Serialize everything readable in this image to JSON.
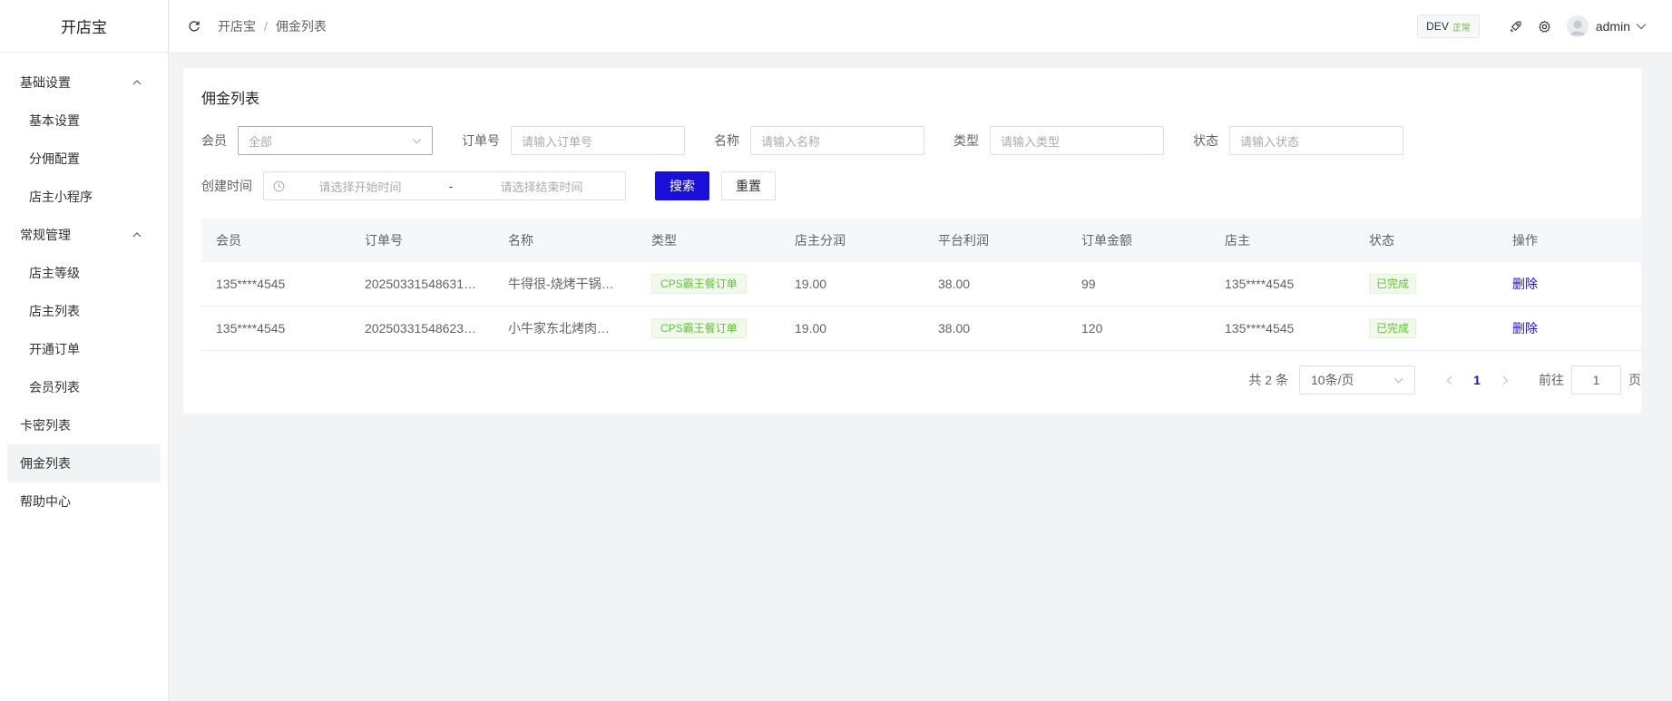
{
  "app": {
    "logo": "开店宝"
  },
  "sidebar": {
    "groups": [
      {
        "label": "基础设置",
        "items": [
          "基本设置",
          "分佣配置",
          "店主小程序"
        ]
      },
      {
        "label": "常规管理",
        "items": [
          "店主等级",
          "店主列表",
          "开通订单",
          "会员列表"
        ]
      }
    ],
    "top_items": [
      "卡密列表",
      "佣金列表",
      "帮助中心"
    ]
  },
  "header": {
    "breadcrumb": [
      "开店宝",
      "佣金列表"
    ],
    "env": "DEV",
    "env_status": "正常",
    "user": "admin"
  },
  "page": {
    "title": "佣金列表",
    "filters": {
      "member": {
        "label": "会员",
        "value": "全部"
      },
      "order_no": {
        "label": "订单号",
        "placeholder": "请输入订单号"
      },
      "name": {
        "label": "名称",
        "placeholder": "请输入名称"
      },
      "type": {
        "label": "类型",
        "placeholder": "请输入类型"
      },
      "status": {
        "label": "状态",
        "placeholder": "请输入状态"
      },
      "created": {
        "label": "创建时间",
        "start_placeholder": "请选择开始时间",
        "separator": "-",
        "end_placeholder": "请选择结束时间"
      },
      "search_label": "搜索",
      "reset_label": "重置"
    },
    "table": {
      "columns": [
        "会员",
        "订单号",
        "名称",
        "类型",
        "店主分润",
        "平台利润",
        "订单金额",
        "店主",
        "状态",
        "操作"
      ],
      "rows": [
        {
          "member": "135****4545",
          "order_no": "20250331548631…",
          "name": "牛得很-烧烤干锅…",
          "type": "CPS霸王餐订单",
          "owner_share": "19.00",
          "platform_profit": "38.00",
          "amount": "99",
          "owner": "135****4545",
          "status": "已完成",
          "action": "删除"
        },
        {
          "member": "135****4545",
          "order_no": "20250331548623…",
          "name": "小牛家东北烤肉…",
          "type": "CPS霸王餐订单",
          "owner_share": "19.00",
          "platform_profit": "38.00",
          "amount": "120",
          "owner": "135****4545",
          "status": "已完成",
          "action": "删除"
        }
      ]
    },
    "pagination": {
      "total": "共 2 条",
      "page_size": "10条/页",
      "current": "1",
      "goto_label": "前往",
      "goto_value": "1",
      "page_unit": "页"
    }
  },
  "colors": {
    "primary": "#1a0fd9",
    "success": "#67c23a"
  }
}
